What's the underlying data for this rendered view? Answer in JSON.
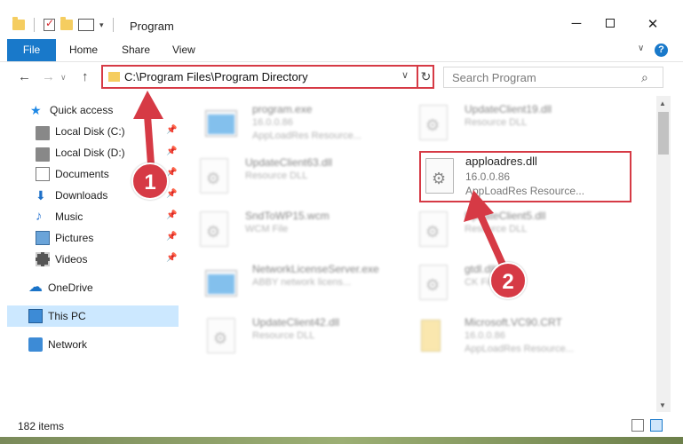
{
  "window": {
    "title": "Program",
    "min_label": "─",
    "close_label": "✕"
  },
  "ribbon": {
    "tabs": [
      "File",
      "Home",
      "Share",
      "View"
    ]
  },
  "address": {
    "path": "C:\\Program Files\\Program Directory"
  },
  "search": {
    "placeholder": "Search Program"
  },
  "sidebar": {
    "quick_access": "Quick access",
    "items": [
      {
        "label": "Local Disk (C:)",
        "icon": "disk-icon"
      },
      {
        "label": "Local Disk (D:)",
        "icon": "disk-icon"
      },
      {
        "label": "Documents",
        "icon": "documents-icon"
      },
      {
        "label": "Downloads",
        "icon": "download-icon"
      },
      {
        "label": "Music",
        "icon": "music-icon"
      },
      {
        "label": "Pictures",
        "icon": "pictures-icon"
      },
      {
        "label": "Videos",
        "icon": "videos-icon"
      }
    ],
    "onedrive": "OneDrive",
    "this_pc": "This PC",
    "network": "Network"
  },
  "files": [
    {
      "name": "program.exe",
      "line2": "16.0.0.86",
      "line3": "AppLoadRes Resource...",
      "type": "exe"
    },
    {
      "name": "UpdateClient19.dll",
      "line2": "Resource DLL",
      "line3": "",
      "type": "dll"
    },
    {
      "name": "UpdateClient63.dll",
      "line2": "Resource DLL",
      "line3": "",
      "type": "dll"
    },
    {
      "name": "SndToWP15.wcm",
      "line2": "WCM File",
      "line3": "",
      "type": "dll"
    },
    {
      "name": "UpdateClient5.dll",
      "line2": "Resource DLL",
      "line3": "",
      "type": "dll"
    },
    {
      "name": "NetworkLicenseServer.exe",
      "line2": "ABBY network licens...",
      "line3": "",
      "type": "exe"
    },
    {
      "name": "gtdl.dll",
      "line2": "CK File",
      "line3": "",
      "type": "dll"
    },
    {
      "name": "UpdateClient42.dll",
      "line2": "Resource DLL",
      "line3": "",
      "type": "dll"
    },
    {
      "name": "Microsoft.VC90.CRT",
      "line2": "16.0.0.86",
      "line3": "AppLoadRes Resource...",
      "type": "crt"
    }
  ],
  "highlighted_file": {
    "name": "apploadres.dll",
    "version": "16.0.0.86",
    "description": "AppLoadRes Resource..."
  },
  "status": {
    "items": "182 items"
  },
  "callouts": [
    "1",
    "2"
  ]
}
